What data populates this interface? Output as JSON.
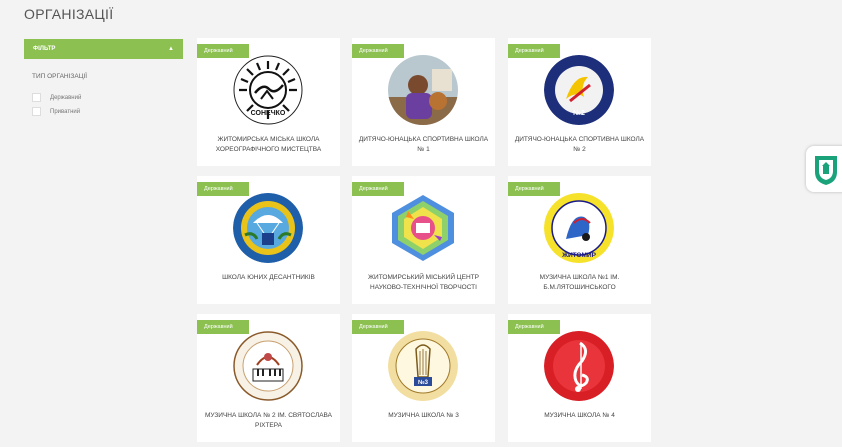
{
  "page": {
    "title": "ОРГАНІЗАЦІЇ"
  },
  "filter": {
    "label": "ФІЛЬТР",
    "caret": "▲",
    "type_heading": "ТИП ОРГАНІЗАЦІЇ",
    "options": [
      {
        "label": "Державний",
        "checked": false
      },
      {
        "label": "Приватний",
        "checked": false
      }
    ]
  },
  "colors": {
    "accent": "#8cc152",
    "background": "#f3f3f3",
    "card": "#ffffff"
  },
  "cards": [
    {
      "badge": "Державний",
      "name": "ЖИТОМИРСЬКА МІСЬКА ШКОЛА ХОРЕОГРАФІЧНОГО МИСТЕЦТВА",
      "logo_icon": "choreography-school-logo",
      "logo_text": "СОНЕЧКО"
    },
    {
      "badge": "Державний",
      "name": "ДИТЯЧО-ЮНАЦЬКА СПОРТИВНА ШКОЛА № 1",
      "logo_icon": "sports-school-photo"
    },
    {
      "badge": "Державний",
      "name": "ДИТЯЧО-ЮНАЦЬКА СПОРТИВНА ШКОЛА № 2",
      "logo_icon": "sports-school-2-logo",
      "logo_text": "№2"
    },
    {
      "badge": "Державний",
      "name": "ШКОЛА ЮНИХ ДЕСАНТНИКІВ",
      "logo_icon": "paratroopers-logo"
    },
    {
      "badge": "Державний",
      "name": "ЖИТОМИРСЬКИЙ МІСЬКИЙ ЦЕНТР НАУКОВО-ТЕХНІЧНОЇ ТВОРЧОСТІ",
      "logo_icon": "science-center-logo"
    },
    {
      "badge": "Державний",
      "name": "МУЗИЧНА ШКОЛА №1 ІМ. Б.М.ЛЯТОШИНСЬКОГО",
      "logo_icon": "music-school-1-logo",
      "logo_text": "ЖИТОМИР"
    },
    {
      "badge": "Державний",
      "name": "МУЗИЧНА ШКОЛА № 2 ІМ. СВЯТОСЛАВА РІХТЕРА",
      "logo_icon": "music-school-2-logo"
    },
    {
      "badge": "Державний",
      "name": "МУЗИЧНА ШКОЛА № 3",
      "logo_icon": "music-school-3-logo",
      "logo_text": "№3"
    },
    {
      "badge": "Державний",
      "name": "МУЗИЧНА ШКОЛА № 4",
      "logo_icon": "music-school-4-logo"
    }
  ],
  "side_tab": {
    "icon": "city-crest-icon"
  }
}
